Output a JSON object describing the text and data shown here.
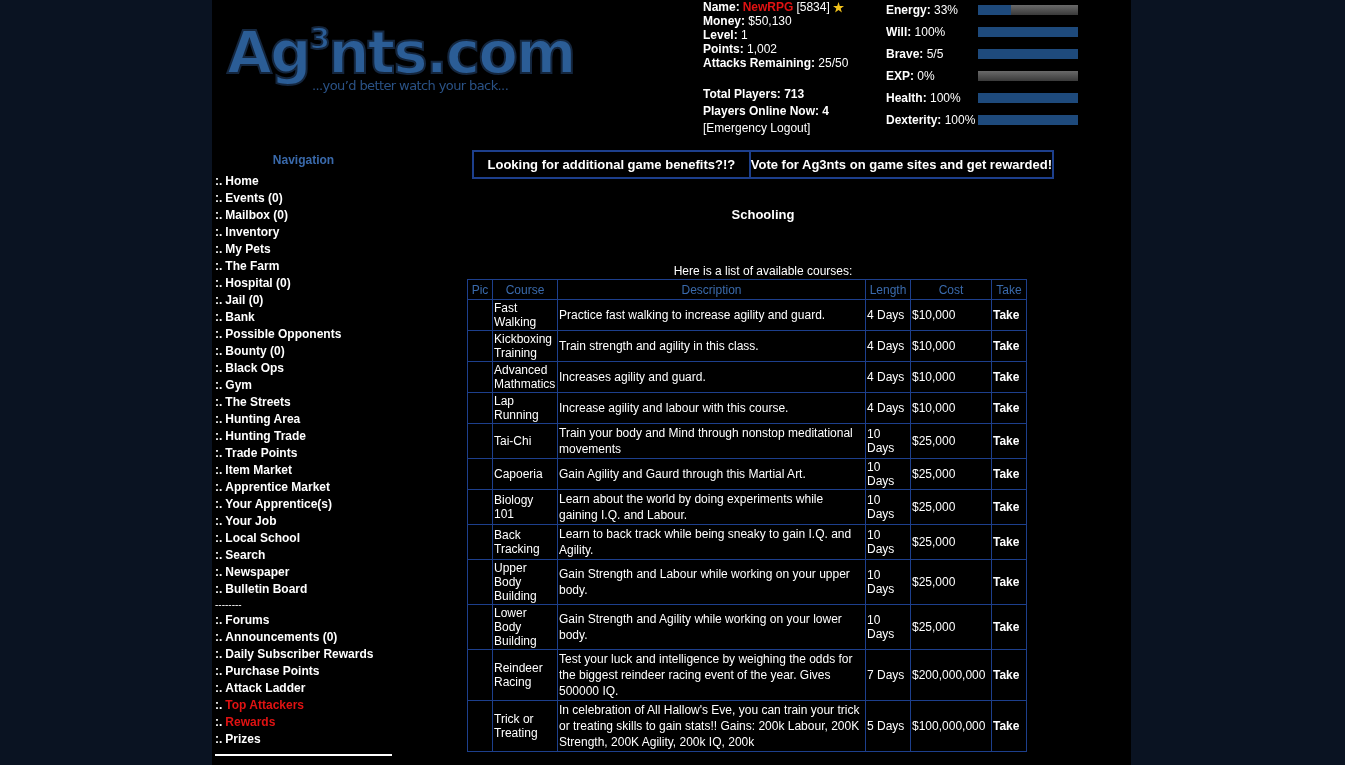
{
  "logo": {
    "title": "Ag$^{3}$nts.com",
    "tagline": "...you’d better watch your back..."
  },
  "player": {
    "name_label": "Name:",
    "name": "NewRPG",
    "id": "[5834]",
    "fields": [
      {
        "label": "Money:",
        "value": "$50,130"
      },
      {
        "label": "Level:",
        "value": "1"
      },
      {
        "label": "Points:",
        "value": "1,002"
      },
      {
        "label": "Attacks Remaining:",
        "value": "25/50"
      }
    ],
    "totals": [
      {
        "label": "Total Players:",
        "value": "713"
      },
      {
        "label": "Players Online Now:",
        "value": "4"
      }
    ],
    "logout": "[Emergency Logout]"
  },
  "meters": [
    {
      "label": "Energy:",
      "reading": "33%",
      "level": 0.33
    },
    {
      "label": "Will:",
      "reading": "100%",
      "level": 1
    },
    {
      "label": "Brave:",
      "reading": "5/5",
      "level": 1
    },
    {
      "label": "EXP:",
      "reading": "0%",
      "level": 0
    },
    {
      "label": "Health:",
      "reading": "100%",
      "level": 1
    },
    {
      "label": "Dexterity:",
      "reading": "100%",
      "level": 1
    }
  ],
  "nav": {
    "title": "Navigation",
    "items": [
      {
        "kind": "link",
        "bullet": ":.",
        "label": "Home",
        "color": "#ffffff"
      },
      {
        "kind": "link",
        "bullet": ":.",
        "label": "Events (0)",
        "color": "#ffffff"
      },
      {
        "kind": "link",
        "bullet": ":.",
        "label": "Mailbox (0)",
        "color": "#ffffff"
      },
      {
        "kind": "link",
        "bullet": ":.",
        "label": "Inventory",
        "color": "#ffffff"
      },
      {
        "kind": "link",
        "bullet": ":.",
        "label": "My Pets",
        "color": "#ffffff"
      },
      {
        "kind": "link",
        "bullet": ":.",
        "label": "The Farm",
        "color": "#ffffff"
      },
      {
        "kind": "link",
        "bullet": ":.",
        "label": "Hospital (0)",
        "color": "#ffffff"
      },
      {
        "kind": "link",
        "bullet": ":.",
        "label": "Jail (0)",
        "color": "#ffffff"
      },
      {
        "kind": "link",
        "bullet": ":.",
        "label": "Bank",
        "color": "#ffffff"
      },
      {
        "kind": "link",
        "bullet": ":.",
        "label": "Possible Opponents",
        "color": "#ffffff"
      },
      {
        "kind": "link",
        "bullet": ":.",
        "label": "Bounty (0)",
        "color": "#ffffff"
      },
      {
        "kind": "link",
        "bullet": ":.",
        "label": "Black Ops",
        "color": "#ffffff"
      },
      {
        "kind": "link",
        "bullet": ":.",
        "label": "Gym",
        "color": "#ffffff"
      },
      {
        "kind": "link",
        "bullet": ":.",
        "label": "The Streets",
        "color": "#ffffff"
      },
      {
        "kind": "link",
        "bullet": ":.",
        "label": "Hunting Area",
        "color": "#ffffff"
      },
      {
        "kind": "link",
        "bullet": ":.",
        "label": "Hunting Trade",
        "color": "#ffffff"
      },
      {
        "kind": "link",
        "bullet": ":.",
        "label": "Trade Points",
        "color": "#ffffff"
      },
      {
        "kind": "link",
        "bullet": ":.",
        "label": "Item Market",
        "color": "#ffffff"
      },
      {
        "kind": "link",
        "bullet": ":.",
        "label": "Apprentice Market",
        "color": "#ffffff"
      },
      {
        "kind": "link",
        "bullet": ":.",
        "label": "Your Apprentice(s)",
        "color": "#ffffff"
      },
      {
        "kind": "link",
        "bullet": ":.",
        "label": "Your Job",
        "color": "#ffffff"
      },
      {
        "kind": "link",
        "bullet": ":.",
        "label": "Local School",
        "color": "#ffffff"
      },
      {
        "kind": "link",
        "bullet": ":.",
        "label": "Search",
        "color": "#ffffff"
      },
      {
        "kind": "link",
        "bullet": ":.",
        "label": "Newspaper",
        "color": "#ffffff"
      },
      {
        "kind": "link",
        "bullet": ":.",
        "label": "Bulletin Board",
        "color": "#ffffff"
      },
      {
        "kind": "separator",
        "label": "--------"
      },
      {
        "kind": "link",
        "bullet": ":.",
        "label": "Forums",
        "color": "#ffffff"
      },
      {
        "kind": "link",
        "bullet": ":.",
        "label": "Announcements (0)",
        "color": "#ffffff"
      },
      {
        "kind": "link",
        "bullet": ":.",
        "label": "Daily Subscriber Rewards",
        "color": "#ffffff"
      },
      {
        "kind": "link",
        "bullet": ":.",
        "label": "Purchase Points",
        "color": "#ffffff"
      },
      {
        "kind": "link",
        "bullet": ":.",
        "label": "Attack Ladder",
        "color": "#ffffff"
      },
      {
        "kind": "link",
        "bullet": ":.",
        "label": "Top Attackers",
        "color": "#e01212"
      },
      {
        "kind": "link",
        "bullet": ":.",
        "label": "Rewards",
        "color": "#e01212"
      },
      {
        "kind": "link",
        "bullet": ":.",
        "label": "Prizes",
        "color": "#ffffff"
      }
    ]
  },
  "banner": [
    "Looking for additional game benefits?!?",
    "Vote for Ag3nts on game sites and get rewarded!"
  ],
  "heading": "Schooling",
  "intro": "Here is a list of available courses:",
  "table": {
    "columns": [
      "Pic",
      "Course",
      "Description",
      "Length",
      "Cost",
      "Take"
    ],
    "rows": [
      {
        "course": "Fast Walking",
        "description": "Practice fast walking to increase agility and guard.",
        "length": "4 Days",
        "cost": "$10,000",
        "take": "Take"
      },
      {
        "course": "Kickboxing Training",
        "description": "Train strength and agility in this class.",
        "length": "4 Days",
        "cost": "$10,000",
        "take": "Take"
      },
      {
        "course": "Advanced Mathmatics",
        "description": "Increases agility and guard.",
        "length": "4 Days",
        "cost": "$10,000",
        "take": "Take"
      },
      {
        "course": "Lap Running",
        "description": "Increase agility and labour with this course.",
        "length": "4 Days",
        "cost": "$10,000",
        "take": "Take"
      },
      {
        "course": "Tai-Chi",
        "description": "Train your body and Mind through nonstop meditational movements",
        "length": "10 Days",
        "cost": "$25,000",
        "take": "Take"
      },
      {
        "course": "Capoeria",
        "description": "Gain Agility and Gaurd through this Martial Art.",
        "length": "10 Days",
        "cost": "$25,000",
        "take": "Take"
      },
      {
        "course": "Biology 101",
        "description": "Learn about the world by doing experiments while gaining I.Q. and Labour.",
        "length": "10 Days",
        "cost": "$25,000",
        "take": "Take"
      },
      {
        "course": "Back Tracking",
        "description": "Learn to back track while being sneaky to gain I.Q. and Agility.",
        "length": "10 Days",
        "cost": "$25,000",
        "take": "Take"
      },
      {
        "course": "Upper Body Building",
        "description": "Gain Strength and Labour while working on your upper body.",
        "length": "10 Days",
        "cost": "$25,000",
        "take": "Take"
      },
      {
        "course": "Lower Body Building",
        "description": "Gain Strength and Agility while working on your lower body.",
        "length": "10 Days",
        "cost": "$25,000",
        "take": "Take"
      },
      {
        "course": "Reindeer Racing",
        "description": "Test your luck and intelligence by weighing the odds for the biggest reindeer racing event of the year. Gives 500000 IQ.",
        "length": "7 Days",
        "cost": "$200,000,000",
        "take": "Take"
      },
      {
        "course": "Trick or Treating",
        "description": "In celebration of All Hallow's Eve, you can train your trick or treating skills to gain stats!! Gains: 200k Labour, 200K Strength, 200K Agility, 200k IQ, 200k",
        "length": "5 Days",
        "cost": "$100,000,000",
        "take": "Take"
      }
    ]
  }
}
